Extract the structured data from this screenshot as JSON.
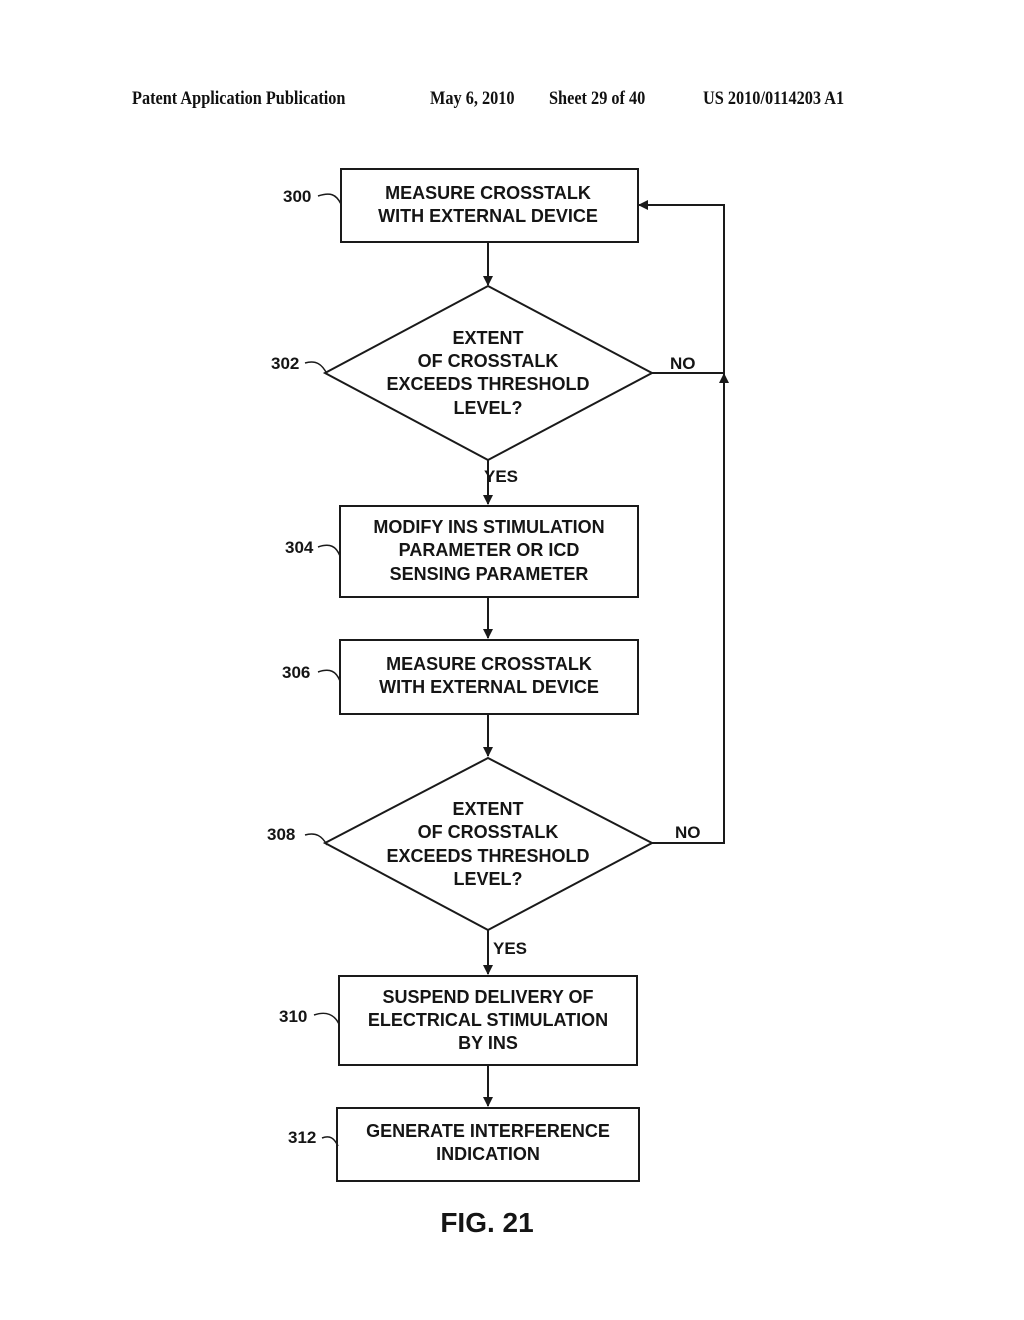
{
  "header": {
    "publication": "Patent Application Publication",
    "date": "May 6, 2010",
    "sheet": "Sheet 29 of 40",
    "number": "US 2010/0114203 A1"
  },
  "figure_label": "FIG. 21",
  "nodes": [
    {
      "id": "300",
      "type": "process",
      "lines": [
        "MEASURE CROSSTALK",
        "WITH EXTERNAL DEVICE"
      ]
    },
    {
      "id": "302",
      "type": "decision",
      "lines": [
        "EXTENT",
        "OF CROSSTALK",
        "EXCEEDS THRESHOLD",
        "LEVEL?"
      ]
    },
    {
      "id": "304",
      "type": "process",
      "lines": [
        "MODIFY INS STIMULATION",
        "PARAMETER OR ICD",
        "SENSING PARAMETER"
      ]
    },
    {
      "id": "306",
      "type": "process",
      "lines": [
        "MEASURE CROSSTALK",
        "WITH EXTERNAL DEVICE"
      ]
    },
    {
      "id": "308",
      "type": "decision",
      "lines": [
        "EXTENT",
        "OF CROSSTALK",
        "EXCEEDS THRESHOLD",
        "LEVEL?"
      ]
    },
    {
      "id": "310",
      "type": "process",
      "lines": [
        "SUSPEND DELIVERY OF",
        "ELECTRICAL STIMULATION",
        "BY INS"
      ]
    },
    {
      "id": "312",
      "type": "process",
      "lines": [
        "GENERATE INTERFERENCE",
        "INDICATION"
      ]
    }
  ],
  "edges": [
    {
      "from": "300",
      "to": "302",
      "label": ""
    },
    {
      "from": "302",
      "to": "304",
      "label": "YES"
    },
    {
      "from": "302",
      "to": "300",
      "label": "NO"
    },
    {
      "from": "304",
      "to": "306",
      "label": ""
    },
    {
      "from": "306",
      "to": "308",
      "label": ""
    },
    {
      "from": "308",
      "to": "310",
      "label": "YES"
    },
    {
      "from": "308",
      "to": "300",
      "label": "NO"
    },
    {
      "from": "310",
      "to": "312",
      "label": ""
    }
  ]
}
